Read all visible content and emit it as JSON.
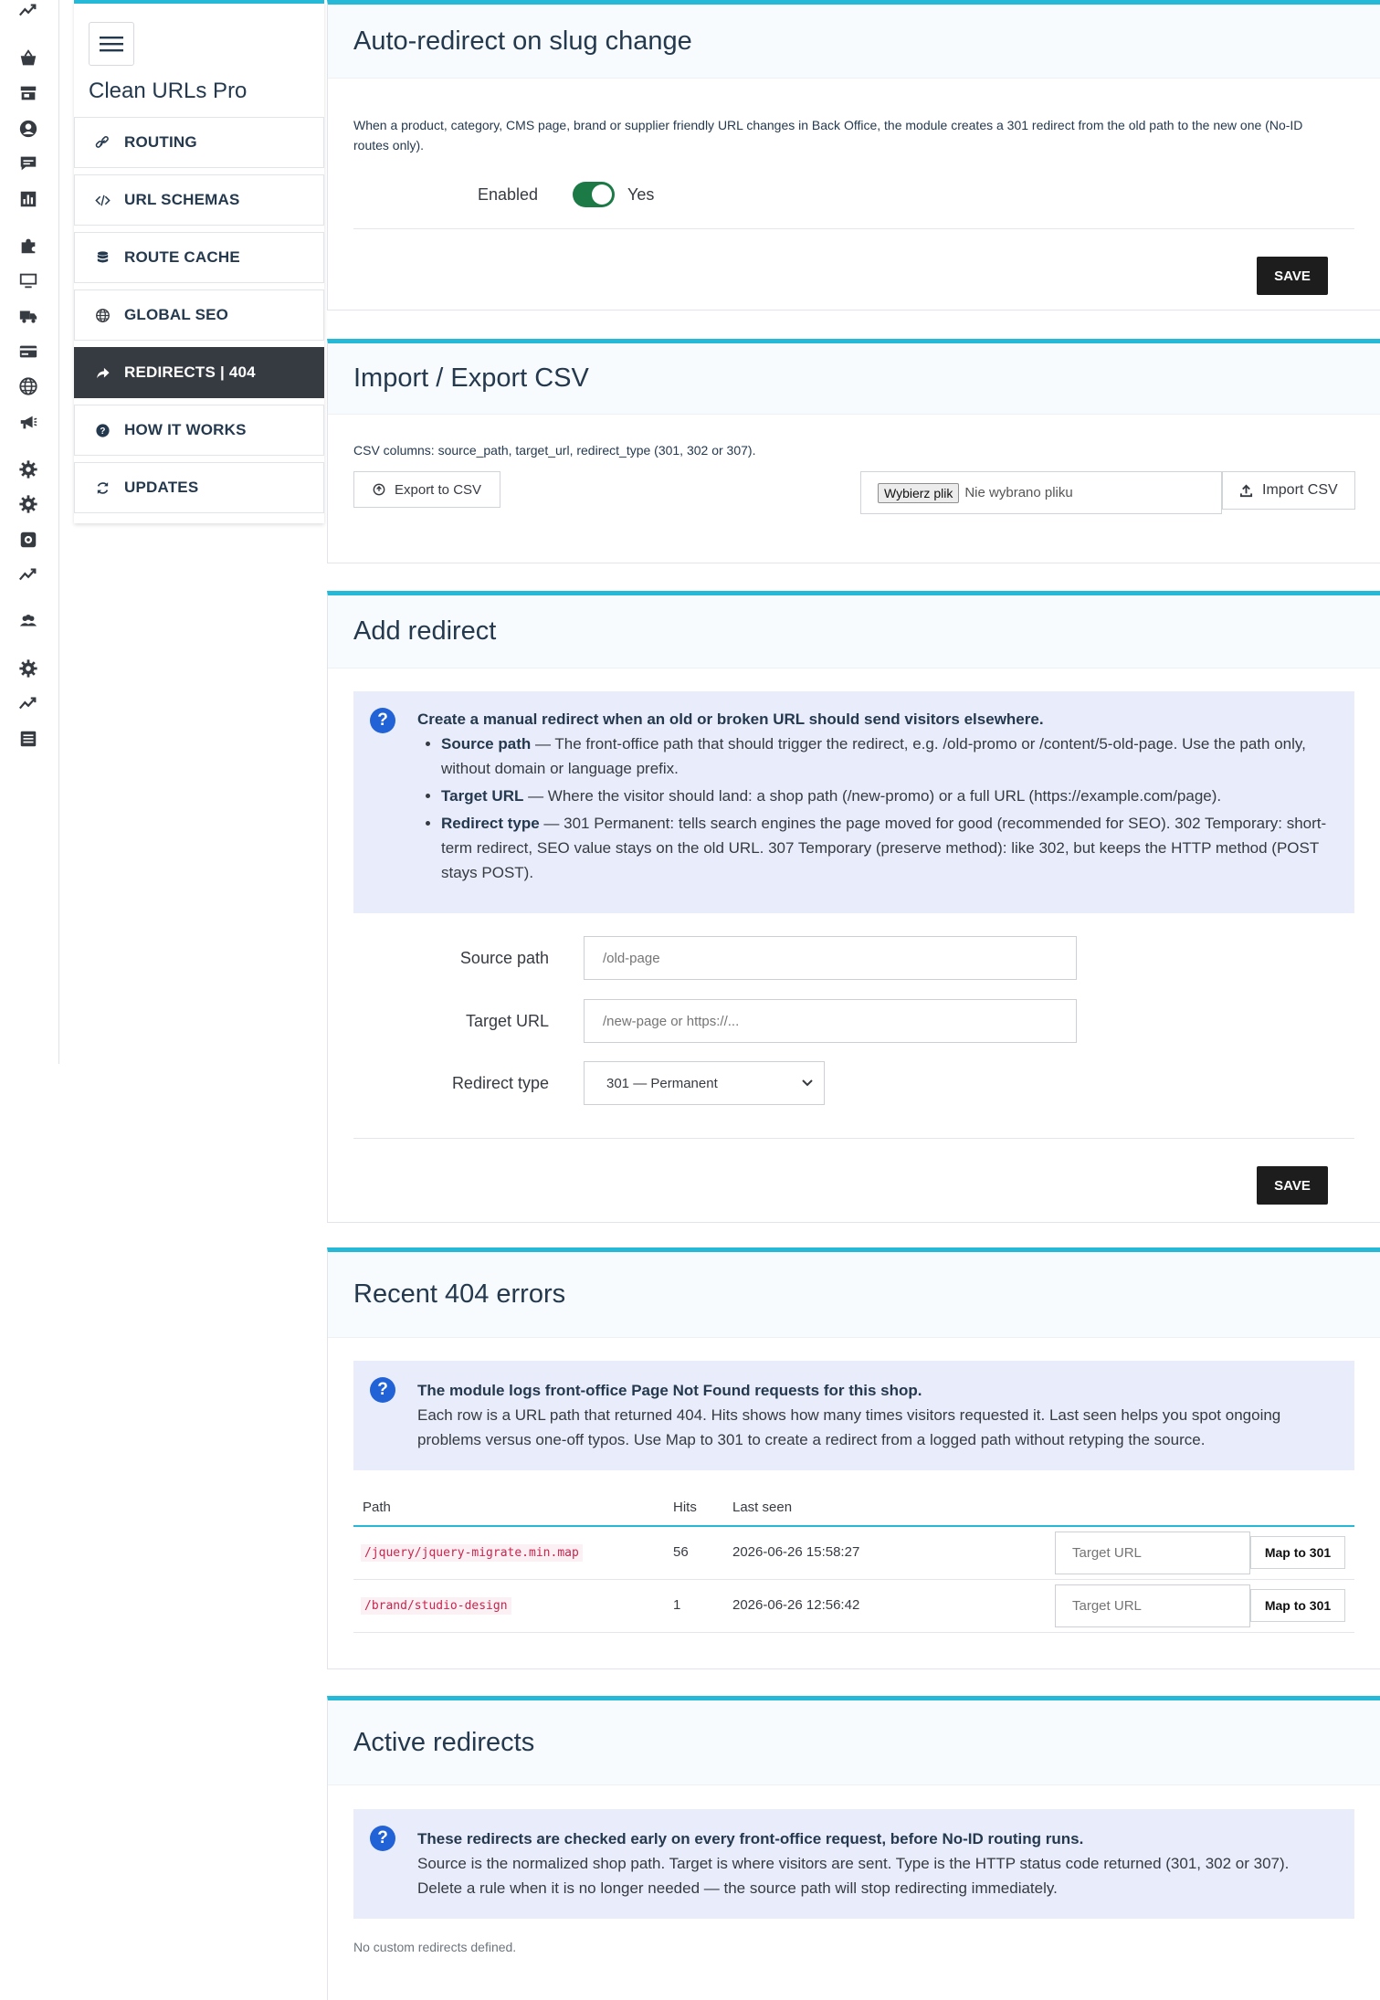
{
  "colors": {
    "accent": "#25b9d7",
    "active_nav": "#363a41",
    "toggle_on": "#1b7a46",
    "info_icon": "#2163d6",
    "info_bg": "#e9ecfb"
  },
  "rail_icons": [
    "trend-up-icon",
    "basket-icon",
    "store-icon",
    "user-circle-icon",
    "chat-icon",
    "chart-icon",
    "puzzle-icon",
    "monitor-icon",
    "truck-icon",
    "card-icon",
    "globe-icon",
    "megaphone-icon",
    "gear-icon",
    "gear-icon",
    "cog-box-icon",
    "trend-up-icon",
    "users-icon",
    "gear-icon",
    "trend-up-icon",
    "list-icon"
  ],
  "module": {
    "title": "Clean URLs Pro"
  },
  "nav": [
    {
      "label": "ROUTING",
      "icon": "link-icon"
    },
    {
      "label": "URL SCHEMAS",
      "icon": "code-icon"
    },
    {
      "label": "ROUTE CACHE",
      "icon": "database-icon"
    },
    {
      "label": "GLOBAL SEO",
      "icon": "globe-icon"
    },
    {
      "label": "REDIRECTS | 404",
      "icon": "share-arrow-icon",
      "active": true
    },
    {
      "label": "HOW IT WORKS",
      "icon": "question-circle-icon"
    },
    {
      "label": "UPDATES",
      "icon": "refresh-icon"
    }
  ],
  "auto_redirect": {
    "title": "Auto-redirect on slug change",
    "description": "When a product, category, CMS page, brand or supplier friendly URL changes in Back Office, the module creates a 301 redirect from the old path to the new one (No-ID routes only).",
    "enabled_label": "Enabled",
    "enabled_value": "Yes",
    "save_label": "SAVE"
  },
  "csv": {
    "title": "Import / Export CSV",
    "description": "CSV columns: source_path, target_url, redirect_type (301, 302 or 307).",
    "export_label": "Export to CSV",
    "file_button": "Wybierz plik",
    "file_status": "Nie wybrano pliku",
    "import_label": "Import CSV"
  },
  "add_redirect": {
    "title": "Add redirect",
    "info_heading": "Create a manual redirect when an old or broken URL should send visitors elsewhere.",
    "bullets": [
      {
        "term": "Source path",
        "text": " — The front-office path that should trigger the redirect, e.g. /old-promo or /content/5-old-page. Use the path only, without domain or language prefix."
      },
      {
        "term": "Target URL",
        "text": " — Where the visitor should land: a shop path (/new-promo) or a full URL (https://example.com/page)."
      },
      {
        "term": "Redirect type",
        "text": " — 301 Permanent: tells search engines the page moved for good (recommended for SEO). 302 Temporary: short-term redirect, SEO value stays on the old URL. 307 Temporary (preserve method): like 302, but keeps the HTTP method (POST stays POST)."
      }
    ],
    "source_label": "Source path",
    "source_placeholder": "/old-page",
    "target_label": "Target URL",
    "target_placeholder": "/new-page or https://...",
    "type_label": "Redirect type",
    "type_value": "301 — Permanent",
    "save_label": "SAVE"
  },
  "errors404": {
    "title": "Recent 404 errors",
    "info_heading": "The module logs front-office Page Not Found requests for this shop.",
    "info_text": "Each row is a URL path that returned 404. Hits shows how many times visitors requested it. Last seen helps you spot ongoing problems versus one-off typos. Use Map to 301 to create a redirect from a logged path without retyping the source.",
    "columns": [
      "Path",
      "Hits",
      "Last seen"
    ],
    "rows": [
      {
        "path": "/jquery/jquery-migrate.min.map",
        "hits": "56",
        "last_seen": "2026-06-26 15:58:27",
        "target_placeholder": "Target URL",
        "map_label": "Map to 301"
      },
      {
        "path": "/brand/studio-design",
        "hits": "1",
        "last_seen": "2026-06-26 12:56:42",
        "target_placeholder": "Target URL",
        "map_label": "Map to 301"
      }
    ]
  },
  "active": {
    "title": "Active redirects",
    "info_heading": "These redirects are checked early on every front-office request, before No-ID routing runs.",
    "info_text": "Source is the normalized shop path. Target is where visitors are sent. Type is the HTTP status code returned (301, 302 or 307). Delete a rule when it is no longer needed — the source path will stop redirecting immediately.",
    "empty": "No custom redirects defined."
  }
}
